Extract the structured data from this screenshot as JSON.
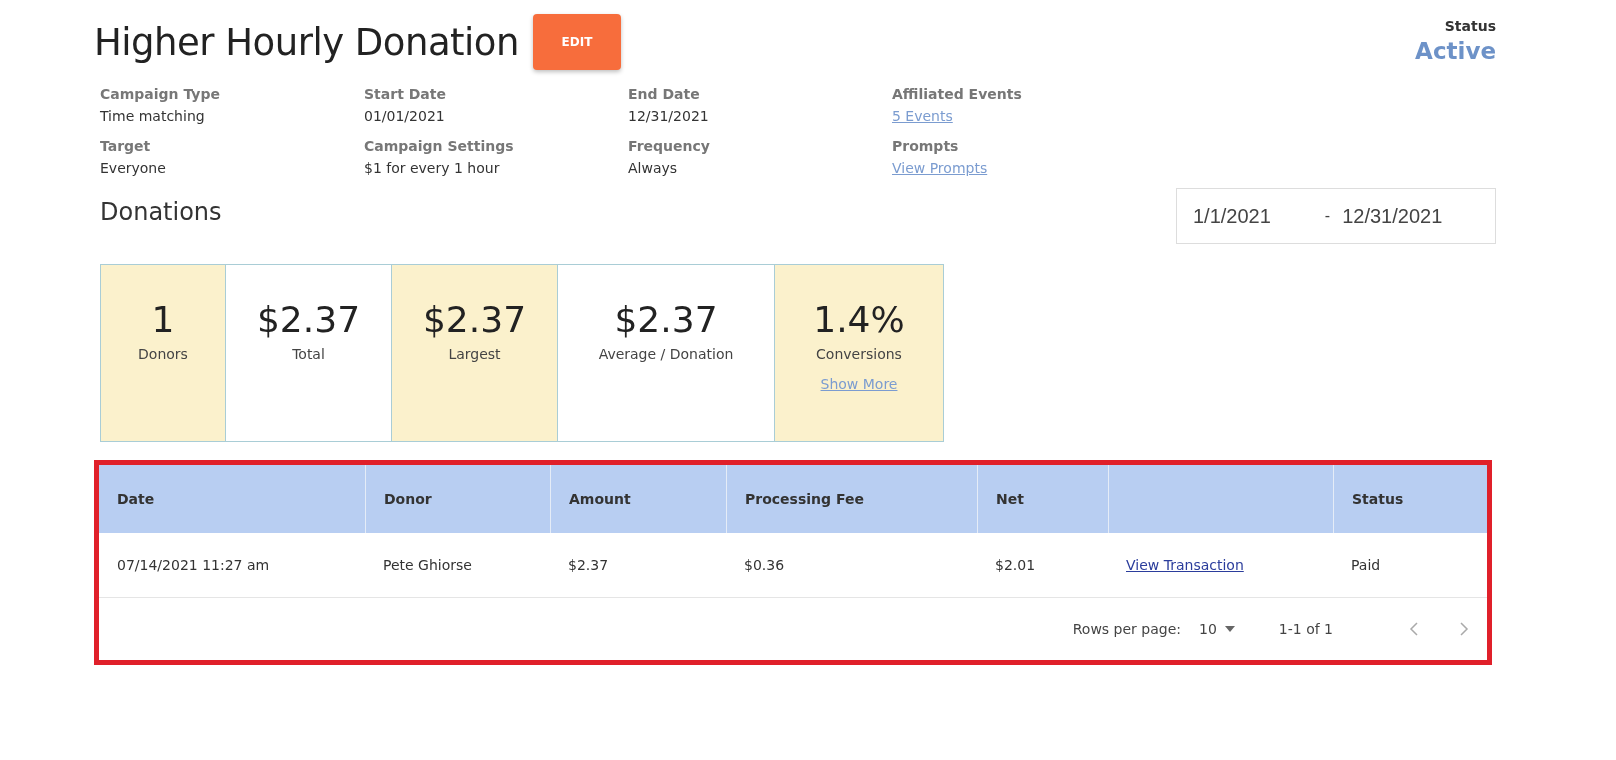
{
  "header": {
    "title": "Higher Hourly Donation",
    "edit_button": "EDIT",
    "status_label": "Status",
    "status_value": "Active"
  },
  "details": [
    {
      "label": "Campaign Type",
      "value": "Time matching",
      "kind": "text"
    },
    {
      "label": "Start Date",
      "value": "01/01/2021",
      "kind": "text"
    },
    {
      "label": "End Date",
      "value": "12/31/2021",
      "kind": "text"
    },
    {
      "label": "Affiliated Events",
      "value": "5 Events",
      "kind": "link"
    },
    {
      "label": "Target",
      "value": "Everyone",
      "kind": "text"
    },
    {
      "label": "Campaign Settings",
      "value": "$1 for every 1 hour",
      "kind": "text"
    },
    {
      "label": "Frequency",
      "value": "Always",
      "kind": "text"
    },
    {
      "label": "Prompts",
      "value": "View Prompts",
      "kind": "link"
    }
  ],
  "donations": {
    "heading": "Donations",
    "date_range": {
      "start": "1/1/2021",
      "separator": "-",
      "end": "12/31/2021"
    }
  },
  "stats": [
    {
      "value": "1",
      "label": "Donors",
      "highlighted": true
    },
    {
      "value": "$2.37",
      "label": "Total",
      "highlighted": false
    },
    {
      "value": "$2.37",
      "label": "Largest",
      "highlighted": true
    },
    {
      "value": "$2.37",
      "label": "Average / Donation",
      "highlighted": false
    },
    {
      "value": "1.4%",
      "label": "Conversions",
      "highlighted": true,
      "link": "Show More"
    }
  ],
  "table": {
    "columns": [
      "Date",
      "Donor",
      "Amount",
      "Processing Fee",
      "Net",
      "",
      "Status"
    ],
    "rows": [
      {
        "cells": [
          {
            "text": "07/14/2021 11:27 am",
            "kind": "text"
          },
          {
            "text": "Pete Ghiorse",
            "kind": "text"
          },
          {
            "text": "$2.37",
            "kind": "text"
          },
          {
            "text": "$0.36",
            "kind": "text"
          },
          {
            "text": "$2.01",
            "kind": "text"
          },
          {
            "text": "View Transaction",
            "kind": "link"
          },
          {
            "text": "Paid",
            "kind": "text"
          }
        ]
      }
    ],
    "footer": {
      "rows_per_page_label": "Rows per page:",
      "rows_per_page": "10",
      "range": "1-1 of 1"
    }
  }
}
